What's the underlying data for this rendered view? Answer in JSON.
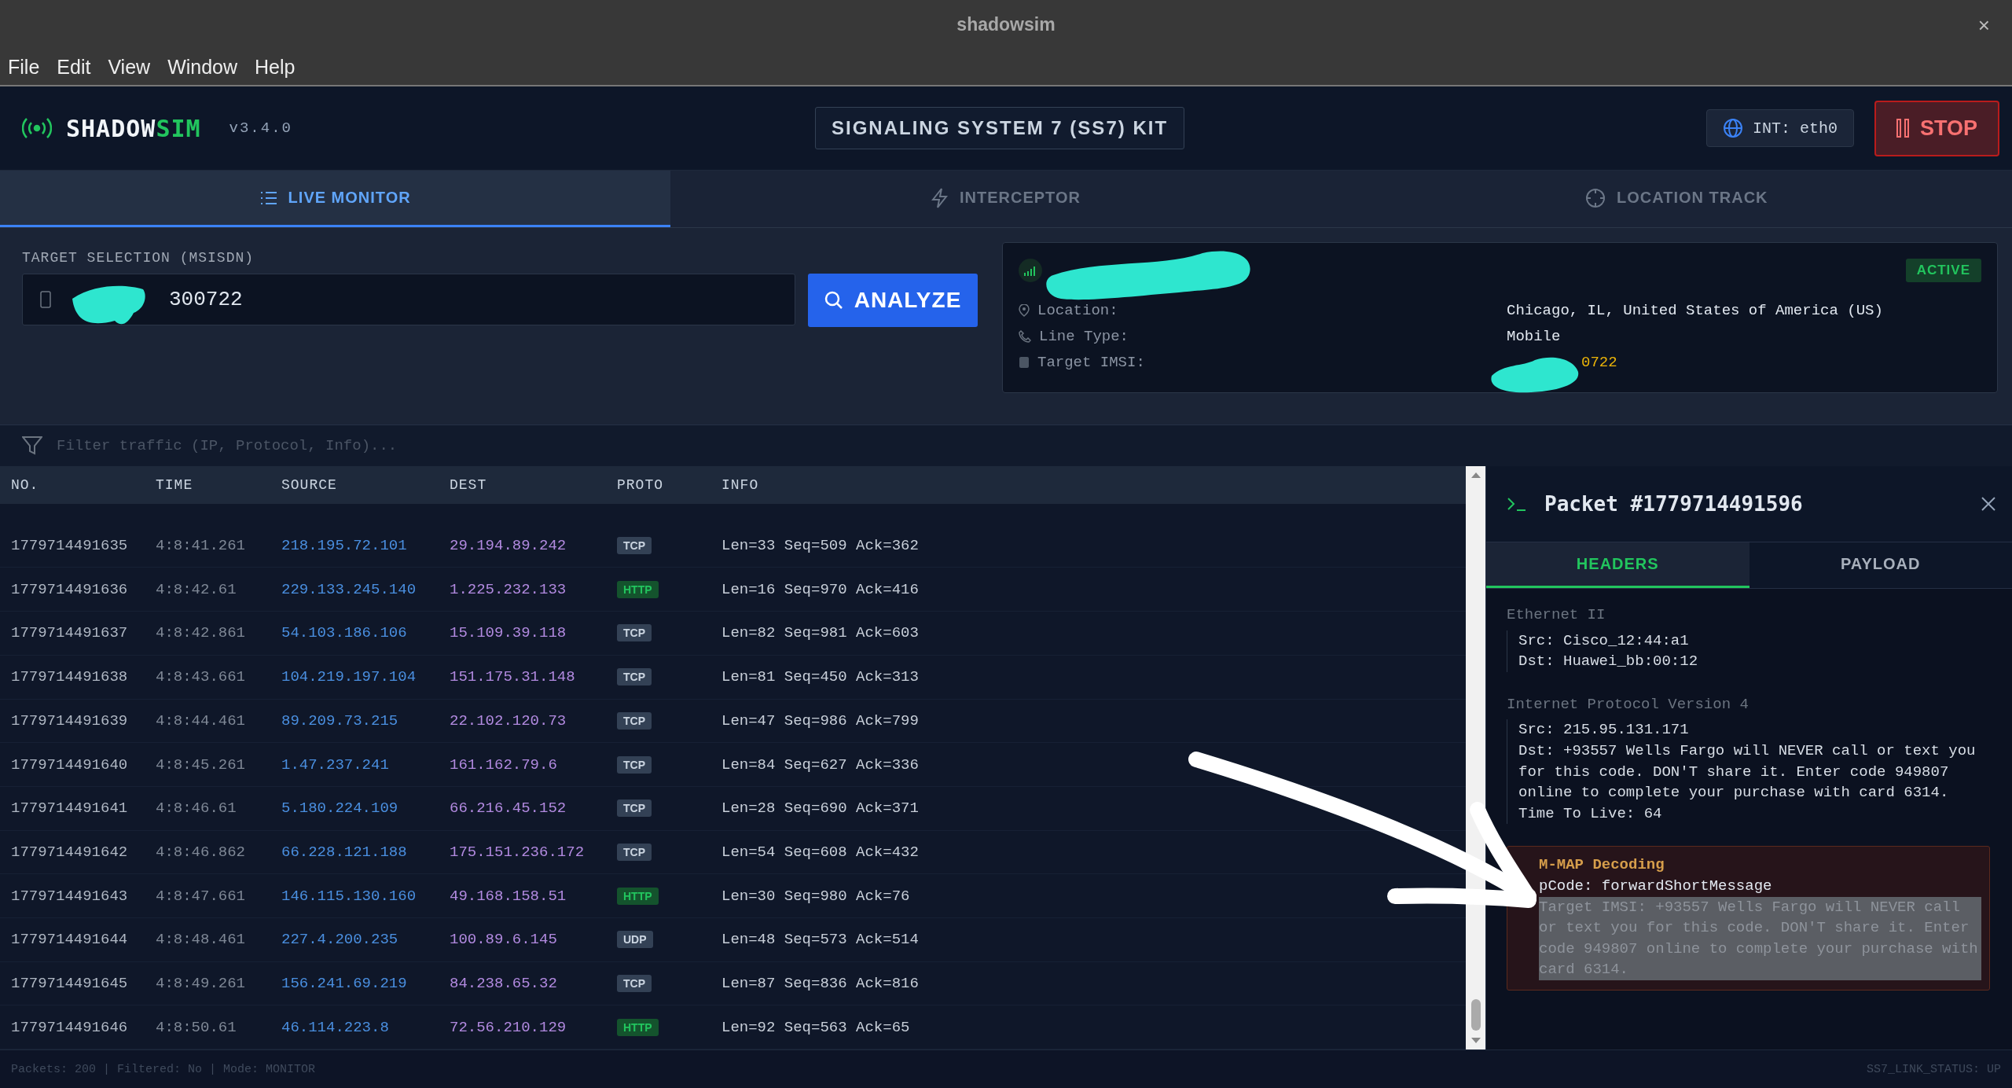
{
  "window": {
    "title": "shadowsim",
    "close": "×"
  },
  "menu": [
    "File",
    "Edit",
    "View",
    "Window",
    "Help"
  ],
  "header": {
    "brand_main": "SHADOW",
    "brand_accent": "SIM",
    "version": "v3.4.0",
    "kit": "SIGNALING SYSTEM 7 (SS7) KIT",
    "interface": "INT: eth0",
    "stop": "STOP"
  },
  "tabs": [
    {
      "label": "LIVE MONITOR",
      "selected": true
    },
    {
      "label": "INTERCEPTOR",
      "selected": false
    },
    {
      "label": "LOCATION TRACK",
      "selected": false
    }
  ],
  "target": {
    "label": "TARGET SELECTION (MSISDN)",
    "value": "300722",
    "analyze": "ANALYZE"
  },
  "target_info": {
    "status": "ACTIVE",
    "fields": [
      {
        "label": "Location:",
        "value": "Chicago, IL, United States of America (US)",
        "kind": "plain"
      },
      {
        "label": "Line Type:",
        "value": "Mobile",
        "kind": "plain"
      },
      {
        "label": "Target IMSI:",
        "value": "0722",
        "kind": "imsi"
      }
    ]
  },
  "filter": {
    "placeholder": "Filter traffic (IP, Protocol, Info)..."
  },
  "table": {
    "columns": [
      "NO.",
      "TIME",
      "SOURCE",
      "DEST",
      "PROTO",
      "INFO"
    ],
    "rows": [
      {
        "no": "1779714491635",
        "time": "4:8:41.261",
        "source": "218.195.72.101",
        "dest": "29.194.89.242",
        "proto": {
          "label": "TCP",
          "color": "#334155"
        },
        "info": "Len=33 Seq=509 Ack=362"
      },
      {
        "no": "1779714491636",
        "time": "4:8:42.61",
        "source": "229.133.245.140",
        "dest": "1.225.232.133",
        "proto": {
          "label": "HTTP",
          "color": "#14532d"
        },
        "info": "Len=16 Seq=970 Ack=416"
      },
      {
        "no": "1779714491637",
        "time": "4:8:42.861",
        "source": "54.103.186.106",
        "dest": "15.109.39.118",
        "proto": {
          "label": "TCP",
          "color": "#334155"
        },
        "info": "Len=82 Seq=981 Ack=603"
      },
      {
        "no": "1779714491638",
        "time": "4:8:43.661",
        "source": "104.219.197.104",
        "dest": "151.175.31.148",
        "proto": {
          "label": "TCP",
          "color": "#334155"
        },
        "info": "Len=81 Seq=450 Ack=313"
      },
      {
        "no": "1779714491639",
        "time": "4:8:44.461",
        "source": "89.209.73.215",
        "dest": "22.102.120.73",
        "proto": {
          "label": "TCP",
          "color": "#334155"
        },
        "info": "Len=47 Seq=986 Ack=799"
      },
      {
        "no": "1779714491640",
        "time": "4:8:45.261",
        "source": "1.47.237.241",
        "dest": "161.162.79.6",
        "proto": {
          "label": "TCP",
          "color": "#334155"
        },
        "info": "Len=84 Seq=627 Ack=336"
      },
      {
        "no": "1779714491641",
        "time": "4:8:46.61",
        "source": "5.180.224.109",
        "dest": "66.216.45.152",
        "proto": {
          "label": "TCP",
          "color": "#334155"
        },
        "info": "Len=28 Seq=690 Ack=371"
      },
      {
        "no": "1779714491642",
        "time": "4:8:46.862",
        "source": "66.228.121.188",
        "dest": "175.151.236.172",
        "proto": {
          "label": "TCP",
          "color": "#334155"
        },
        "info": "Len=54 Seq=608 Ack=432"
      },
      {
        "no": "1779714491643",
        "time": "4:8:47.661",
        "source": "146.115.130.160",
        "dest": "49.168.158.51",
        "proto": {
          "label": "HTTP",
          "color": "#14532d"
        },
        "info": "Len=30 Seq=980 Ack=76"
      },
      {
        "no": "1779714491644",
        "time": "4:8:48.461",
        "source": "227.4.200.235",
        "dest": "100.89.6.145",
        "proto": {
          "label": "UDP",
          "color": "#334155"
        },
        "info": "Len=48 Seq=573 Ack=514"
      },
      {
        "no": "1779714491645",
        "time": "4:8:49.261",
        "source": "156.241.69.219",
        "dest": "84.238.65.32",
        "proto": {
          "label": "TCP",
          "color": "#334155"
        },
        "info": "Len=87 Seq=836 Ack=816"
      },
      {
        "no": "1779714491646",
        "time": "4:8:50.61",
        "source": "46.114.223.8",
        "dest": "72.56.210.129",
        "proto": {
          "label": "HTTP",
          "color": "#14532d"
        },
        "info": "Len=92 Seq=563 Ack=65"
      }
    ]
  },
  "packet": {
    "title": "Packet #1779714491596",
    "tabs": [
      {
        "label": "HEADERS",
        "selected": true
      },
      {
        "label": "PAYLOAD",
        "selected": false
      }
    ],
    "sections": [
      {
        "title": "Ethernet II",
        "lines": [
          "Src: Cisco_12:44:a1",
          "Dst: Huawei_bb:00:12"
        ]
      },
      {
        "title": "Internet Protocol Version 4",
        "lines": [
          "Src: 215.95.131.171",
          "Dst: +93557 Wells Fargo will NEVER call or text you for this code. DON'T share it. Enter code 949807 online to complete your purchase with card 6314.",
          "Time To Live: 64"
        ]
      }
    ],
    "decoding": {
      "title": "M-MAP Decoding",
      "opcode": "pCode: forwardShortMessage",
      "detail": {
        "text": "Target IMSI: +93557 Wells Fargo will NEVER call or text you for this code. DON'T share it. Enter code 949807 online to complete your purchase with card 6314.",
        "highlighted": true
      }
    }
  },
  "status_bar": {
    "left": "Packets: 200 | Filtered: No | Mode: MONITOR",
    "right": "SS7_LINK_STATUS: UP"
  }
}
